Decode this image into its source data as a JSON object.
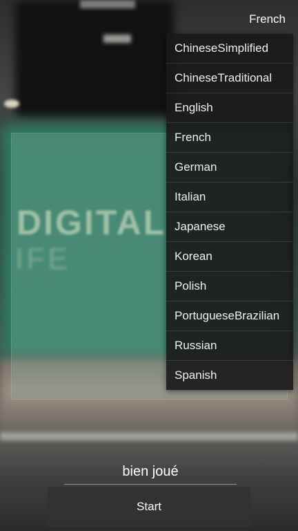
{
  "language_selector": {
    "current": "French",
    "options": [
      "ChineseSimplified",
      "ChineseTraditional",
      "English",
      "French",
      "German",
      "Italian",
      "Japanese",
      "Korean",
      "Polish",
      "PortugueseBrazilian",
      "Russian",
      "Spanish"
    ]
  },
  "camera_scene_text": [
    "DIGITAL",
    "IFE"
  ],
  "input": {
    "value": "bien joué"
  },
  "start_label": "Start"
}
